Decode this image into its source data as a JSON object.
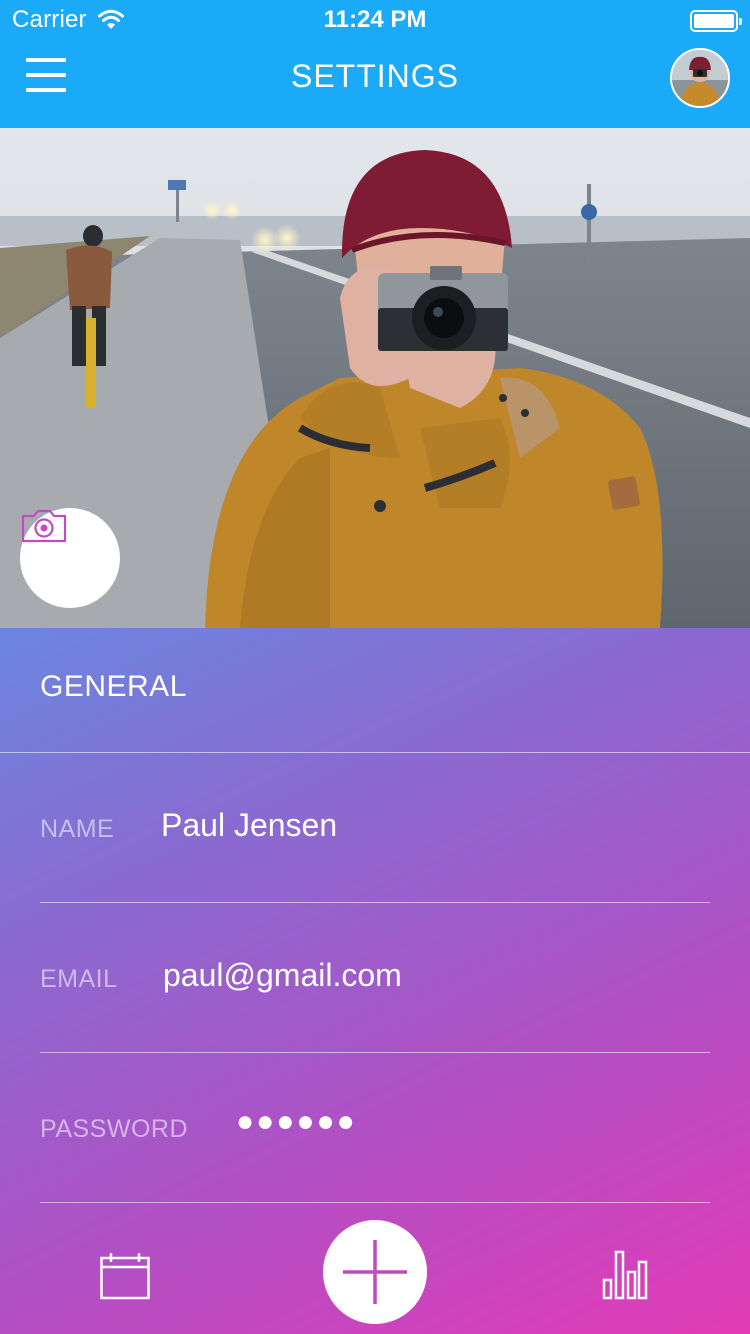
{
  "status_bar": {
    "carrier": "Carrier",
    "time": "11:24 PM",
    "wifi_icon": "wifi-icon",
    "battery_icon": "battery-icon"
  },
  "header": {
    "title": "SETTINGS",
    "menu_icon": "hamburger-menu-icon",
    "avatar": "user-avatar",
    "background": "#1aaaf7"
  },
  "hero": {
    "camera_icon": "camera-icon",
    "accent": "#c34bc0"
  },
  "general": {
    "section_title": "GENERAL",
    "fields": [
      {
        "label": "NAME",
        "value": "Paul Jensen"
      },
      {
        "label": "EMAIL",
        "value": "paul@gmail.com"
      },
      {
        "label": "PASSWORD",
        "value": "●●●●●●"
      }
    ]
  },
  "tab_bar": {
    "calendar_icon": "calendar-icon",
    "add_icon": "plus-icon",
    "stats_icon": "bar-chart-icon",
    "add_accent": "#c04bbf"
  }
}
